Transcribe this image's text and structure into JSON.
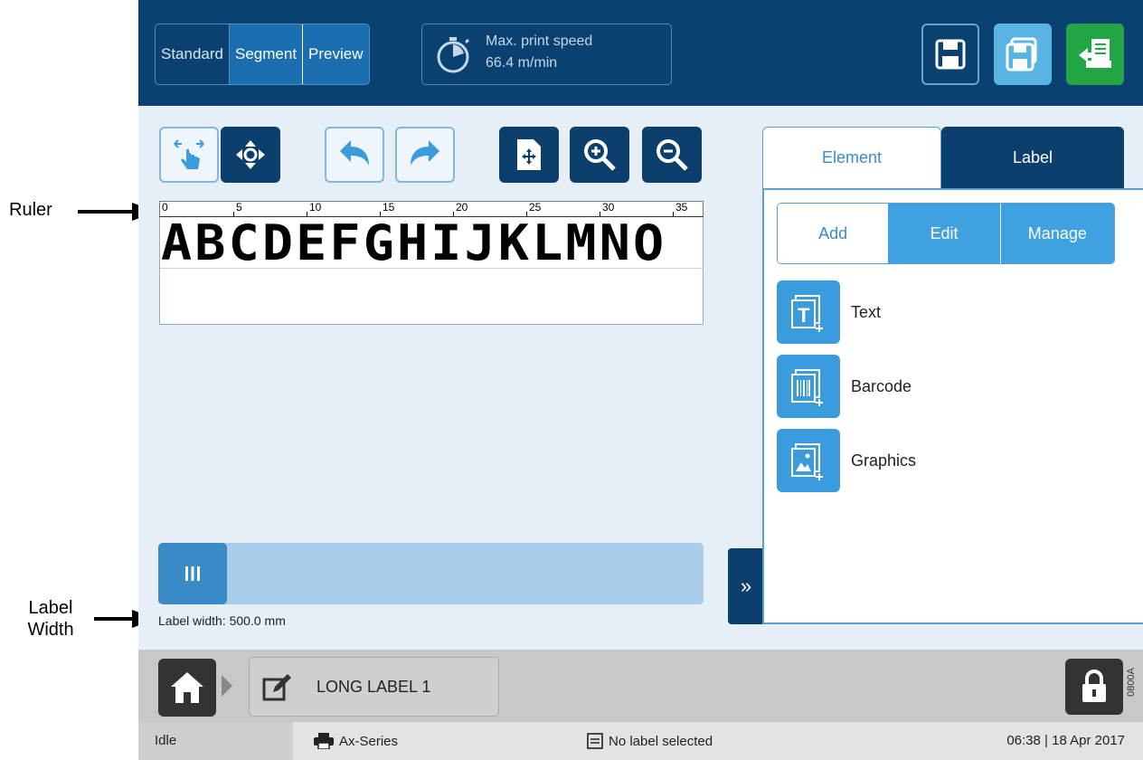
{
  "annotations": {
    "ruler": "Ruler",
    "label_width_line1": "Label",
    "label_width_line2": "Width"
  },
  "header": {
    "view_modes": [
      "Standard",
      "Segment",
      "Preview"
    ],
    "active_mode": "Segment",
    "speed_title": "Max. print speed",
    "speed_value": "66.4 m/min",
    "colors": {
      "bar": "#0b4170",
      "accent": "#1b6fb1",
      "exit": "#22a545",
      "save_as": "#59b4e4"
    }
  },
  "toolbar": {
    "icons": [
      "touch-pan-icon",
      "move-element-icon",
      "undo-icon",
      "redo-icon",
      "fit-page-icon",
      "zoom-in-icon",
      "zoom-out-icon"
    ]
  },
  "editor": {
    "ruler_ticks": [
      "0",
      "5",
      "10",
      "15",
      "20",
      "25",
      "30",
      "35"
    ],
    "canvas_text": "ABCDEFGHIJKLMNO",
    "label_width": "Label width: 500.0 mm"
  },
  "panel": {
    "tabs": [
      "Element",
      "Label"
    ],
    "active_tab": "Element",
    "subtabs": [
      "Add",
      "Edit",
      "Manage"
    ],
    "active_subtab": "Add",
    "elements": [
      {
        "label": "Text",
        "icon": "text-element-icon"
      },
      {
        "label": "Barcode",
        "icon": "barcode-element-icon"
      },
      {
        "label": "Graphics",
        "icon": "graphics-element-icon"
      }
    ]
  },
  "bottom": {
    "label_name": "LONG LABEL 1",
    "side_code": "0800A"
  },
  "status": {
    "state": "Idle",
    "printer": "Ax-Series",
    "label": "No label selected",
    "time": "06:38 | 18 Apr 2017"
  }
}
